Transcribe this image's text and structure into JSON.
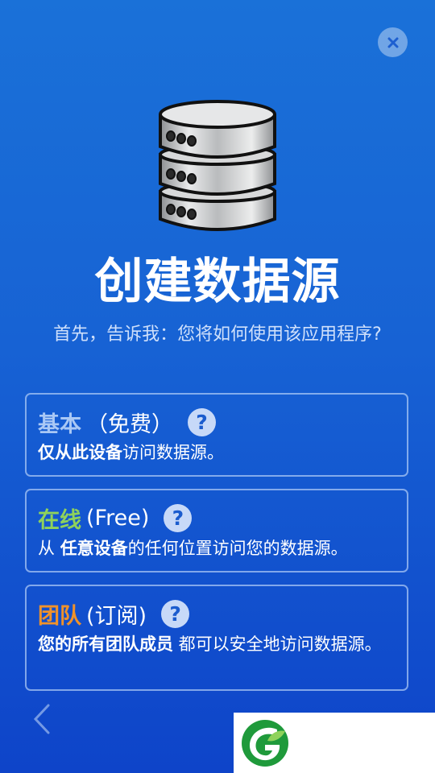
{
  "title": "创建数据源",
  "subtitle": "首先，告诉我：您将如何使用该应用程序?",
  "options": [
    {
      "name": "基本",
      "paren": "（免费）",
      "name_color": "#a9c8f5",
      "desc_bold": "仅从此设备",
      "desc_rest": "访问数据源。"
    },
    {
      "name": "在线",
      "paren": "(Free)",
      "name_color": "#8fd25b",
      "desc_pre": "从 ",
      "desc_bold": "任意设备",
      "desc_rest": "的任何位置访问您的数据源。"
    },
    {
      "name": "团队",
      "paren": "(订阅)",
      "name_color": "#f0922a",
      "desc_bold": "您的所有团队成员",
      "desc_rest": " 都可以安全地访问数据源。"
    }
  ],
  "help_symbol": "?",
  "icons": {
    "close": "close-icon",
    "database": "database-icon",
    "help": "help-icon",
    "back": "chevron-left-icon",
    "logo": "leaf-logo-icon"
  }
}
